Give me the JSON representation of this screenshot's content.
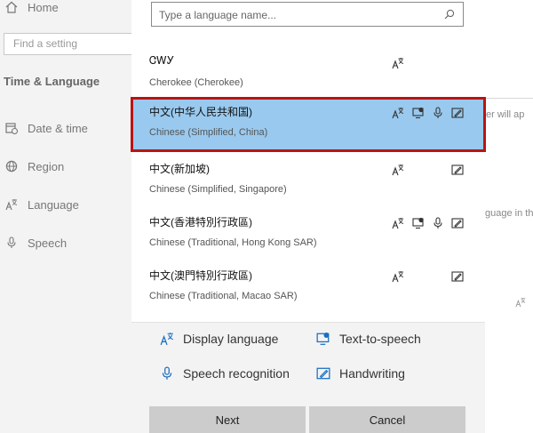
{
  "sidebar": {
    "home_label": "Home",
    "find_placeholder": "Find a setting",
    "section_title": "Time & Language",
    "items": [
      {
        "label": "Date & time",
        "icon": "calendar-clock-icon"
      },
      {
        "label": "Region",
        "icon": "globe-icon"
      },
      {
        "label": "Language",
        "icon": "language-icon"
      },
      {
        "label": "Speech",
        "icon": "microphone-icon"
      }
    ]
  },
  "background": {
    "text1": "er will ap",
    "text2": "guage in th"
  },
  "dialog": {
    "search_placeholder": "Type a language name...",
    "languages": [
      {
        "native": "ᏣᎳᎩ",
        "english": "Cherokee (Cherokee)",
        "caps": [
          "display-language"
        ],
        "selected": false
      },
      {
        "native": "中文(中华人民共和国)",
        "english": "Chinese (Simplified, China)",
        "caps": [
          "display-language",
          "text-to-speech",
          "speech-recognition",
          "handwriting"
        ],
        "selected": true
      },
      {
        "native": "中文(新加坡)",
        "english": "Chinese (Simplified, Singapore)",
        "caps": [
          "display-language",
          "handwriting"
        ],
        "selected": false
      },
      {
        "native": "中文(香港特別行政區)",
        "english": "Chinese (Traditional, Hong Kong SAR)",
        "caps": [
          "display-language",
          "text-to-speech",
          "speech-recognition",
          "handwriting"
        ],
        "selected": false
      },
      {
        "native": "中文(澳門特別行政區)",
        "english": "Chinese (Traditional, Macao SAR)",
        "caps": [
          "display-language",
          "handwriting"
        ],
        "selected": false
      }
    ],
    "legend": {
      "display_language": "Display language",
      "text_to_speech": "Text-to-speech",
      "speech_recognition": "Speech recognition",
      "handwriting": "Handwriting"
    },
    "next_label": "Next",
    "cancel_label": "Cancel"
  }
}
